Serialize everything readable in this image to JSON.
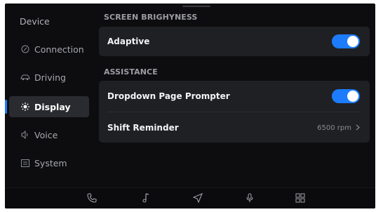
{
  "sidebar": {
    "items": [
      {
        "label": "Device",
        "icon": "",
        "active": false
      },
      {
        "label": "Connection",
        "icon": "connection-icon",
        "active": false
      },
      {
        "label": "Driving",
        "icon": "car-icon",
        "active": false
      },
      {
        "label": "Display",
        "icon": "brightness-icon",
        "active": true
      },
      {
        "label": "Voice",
        "icon": "voice-icon",
        "active": false
      },
      {
        "label": "System",
        "icon": "system-icon",
        "active": false
      }
    ]
  },
  "main": {
    "screen_brightness": {
      "header": "SCREEN BRIGHYNESS",
      "adaptive_label": "Adaptive",
      "adaptive_on": true
    },
    "assistance": {
      "header": "ASSISTANCE",
      "dropdown_prompter_label": "Dropdown Page Prompter",
      "dropdown_prompter_on": true,
      "shift_reminder_label": "Shift Reminder",
      "shift_reminder_value": "6500 rpm"
    }
  },
  "dock": {
    "icons": [
      "phone-icon",
      "music-icon",
      "navigation-icon",
      "microphone-icon",
      "apps-grid-icon"
    ]
  },
  "colors": {
    "accent": "#1c7cfb",
    "background": "#0d0d0f",
    "card": "#1f2024"
  }
}
